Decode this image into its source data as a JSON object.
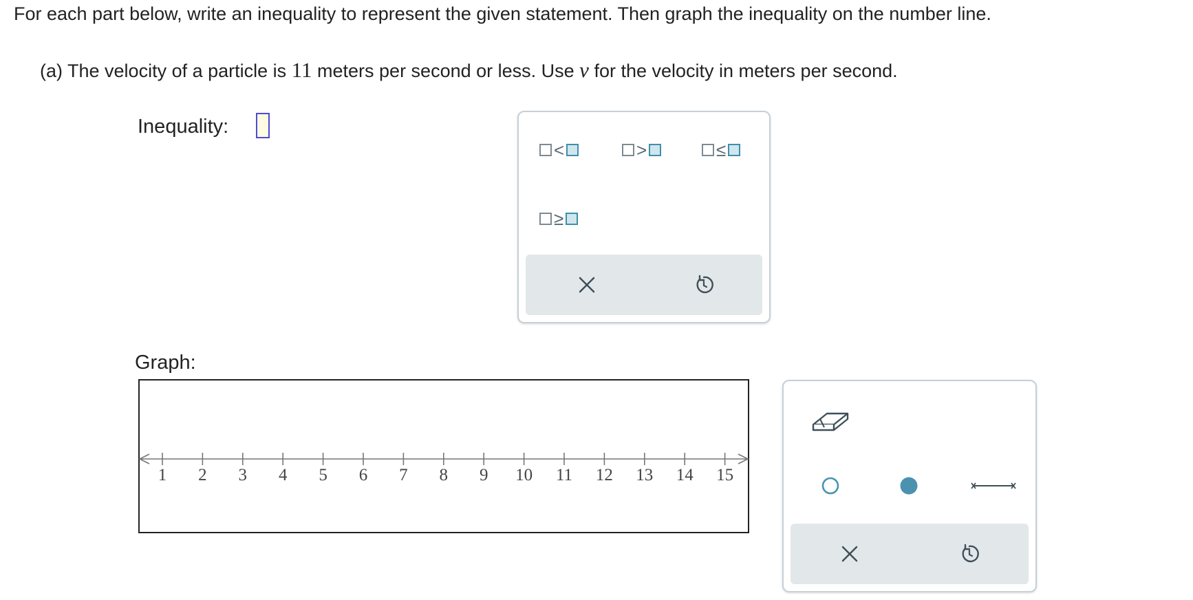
{
  "instructions": "For each part below, write an inequality to represent the given statement. Then graph the inequality on the number line.",
  "question": {
    "prefix": "(a) The velocity of a particle is ",
    "number": "11",
    "middle": " meters per second or less. Use ",
    "variable": "v",
    "suffix": " for the velocity in meters per second."
  },
  "inequality": {
    "label": "Inequality:"
  },
  "symbols": {
    "lt": "<",
    "gt": ">",
    "le": "≤",
    "ge": "≥"
  },
  "graph": {
    "label": "Graph:",
    "number_line": {
      "min": 1,
      "max": 15,
      "ticks": [
        "1",
        "2",
        "3",
        "4",
        "5",
        "6",
        "7",
        "8",
        "9",
        "10",
        "11",
        "12",
        "13",
        "14",
        "15"
      ]
    }
  },
  "tools": [
    "eraser-icon",
    "open-circle-icon",
    "closed-circle-icon",
    "segment-icon"
  ],
  "actions": [
    "clear-icon",
    "undo-icon"
  ],
  "colors": {
    "accent": "#4a92b0",
    "border": "#c7d0d6",
    "action_bar": "#e2e7ea",
    "answer_box_fill": "#fefce0",
    "answer_box_border": "#4b4bd6"
  }
}
